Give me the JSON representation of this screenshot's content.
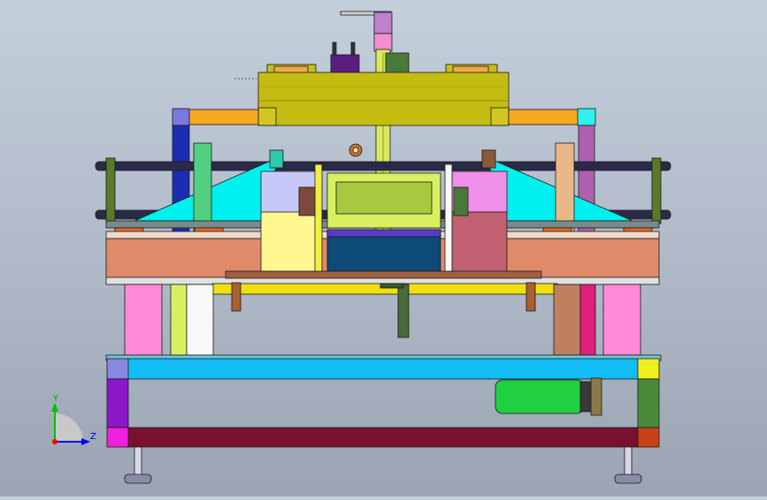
{
  "viewport": {
    "background_top": "#c4cfdc",
    "background_bottom": "#9aa4b2"
  },
  "triad": {
    "y_label": "Y",
    "z_label": "Z",
    "y_color": "#00c000",
    "z_color": "#0000ff",
    "origin_color": "#ff0000"
  },
  "palette": {
    "outline": "#1a1a1a",
    "top_plate": "#c8c010",
    "orange_beam": "#f5a822",
    "blue_column": "#1a2fb0",
    "violet_column": "#b060b0",
    "cyan_wedge": "#00f0f0",
    "salmon_table": "#e08a6a",
    "pink_leg": "#ff8ad8",
    "cyan_base_beam": "#12bdf5",
    "maroon_base_beam": "#7a1030",
    "yellow_shaft": "#f0e010",
    "green_motor": "#20d040",
    "olive_slide": "#a8c840",
    "navy_box": "#0e4a78",
    "lavender_block": "#c8c8f8",
    "pink_block": "#e890e0",
    "rose_block": "#c06070"
  }
}
